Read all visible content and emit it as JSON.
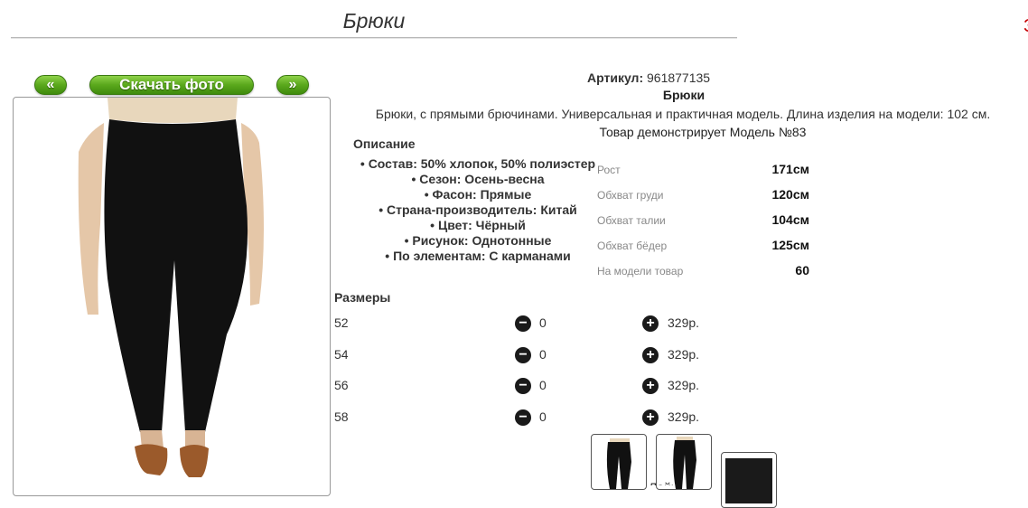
{
  "page": {
    "title": "Брюки",
    "edge_mark": "З"
  },
  "gallery": {
    "prev_label": "«",
    "download_label": "Скачать фото",
    "next_label": "»",
    "thumb_caption": "Лайк"
  },
  "product": {
    "article_label": "Артикул:",
    "article_value": "961877135",
    "name": "Брюки",
    "description": "Брюки, с прямыми брючинами. Универсальная и практичная модель. Длина изделия на модели: 102 см.",
    "model_note": "Товар демонстрирует Модель №83",
    "description_heading": "Описание",
    "properties": [
      "Состав: 50% хлопок, 50% полиэстер",
      "Сезон: Осень-весна",
      "Фасон: Прямые",
      "Страна-производитель: Китай",
      "Цвет: Чёрный",
      "Рисунок: Однотонные",
      "По элементам: С карманами"
    ]
  },
  "model_measurements": [
    {
      "label": "Рост",
      "value": "171см"
    },
    {
      "label": "Обхват груди",
      "value": "120см"
    },
    {
      "label": "Обхват талии",
      "value": "104см"
    },
    {
      "label": "Обхват бёдер",
      "value": "125см"
    },
    {
      "label": "На модели товар",
      "value": "60"
    }
  ],
  "sizes": {
    "heading": "Размеры",
    "rows": [
      {
        "size": "52",
        "qty": "0",
        "price": "329р."
      },
      {
        "size": "54",
        "qty": "0",
        "price": "329р."
      },
      {
        "size": "56",
        "qty": "0",
        "price": "329р."
      },
      {
        "size": "58",
        "qty": "0",
        "price": "329р."
      }
    ]
  },
  "icons": {
    "minus": "minus-circle-icon",
    "plus": "plus-circle-icon"
  },
  "colors": {
    "button_green": "#5aa81c",
    "garment": "#111111"
  }
}
